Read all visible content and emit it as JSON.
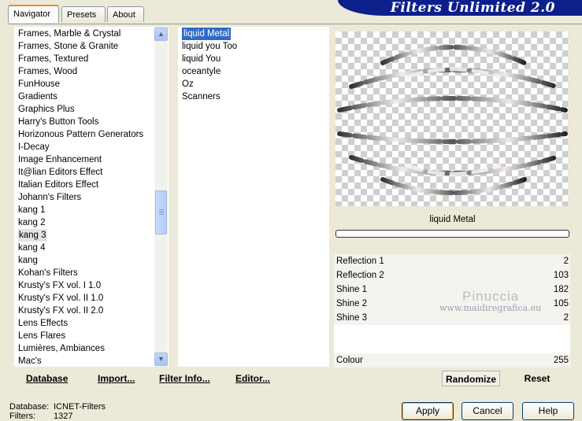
{
  "tabs": {
    "navigator": "Navigator",
    "presets": "Presets",
    "about": "About"
  },
  "banner": {
    "title": "Filters Unlimited 2.0"
  },
  "categories": [
    "Frames, Marble & Crystal",
    "Frames, Stone & Granite",
    "Frames, Textured",
    "Frames, Wood",
    "FunHouse",
    "Gradients",
    "Graphics Plus",
    "Harry's Button Tools",
    "Horizonous Pattern Generators",
    "I-Decay",
    "Image Enhancement",
    "It@lian Editors Effect",
    "Italian Editors Effect",
    "Johann's Filters",
    "kang 1",
    "kang 2",
    "kang 3",
    "kang 4",
    "kang",
    "Kohan's Filters",
    "Krusty's FX vol. I 1.0",
    "Krusty's FX vol. II 1.0",
    "Krusty's FX vol. II 2.0",
    "Lens Effects",
    "Lens Flares",
    "Lumières, Ambiances",
    "Mac's"
  ],
  "selected_category": "kang 3",
  "filters": [
    "liquid Metal",
    "liquid you Too",
    "liquid You",
    "oceantyle",
    "Oz",
    "Scanners"
  ],
  "selected_filter": "liquid Metal",
  "preview": {
    "filter_name": "liquid Metal"
  },
  "params": [
    {
      "label": "Reflection 1",
      "value": "2"
    },
    {
      "label": "Reflection 2",
      "value": "103"
    },
    {
      "label": "Shine 1",
      "value": "182"
    },
    {
      "label": "Shine 2",
      "value": "105"
    },
    {
      "label": "Shine 3",
      "value": "2"
    },
    {
      "label": "Colour",
      "value": "255"
    }
  ],
  "watermark": {
    "line1": "Pinuccia",
    "line2": "www.maidiregrafica.eu"
  },
  "actions": {
    "database": "Database",
    "import": "Import...",
    "filter_info": "Filter Info...",
    "editor": "Editor...",
    "randomize": "Randomize",
    "reset": "Reset"
  },
  "footer": {
    "database_label": "Database:",
    "database_value": "ICNET-Filters",
    "filters_label": "Filters:",
    "filters_value": "1327"
  },
  "dialog_buttons": {
    "apply": "Apply",
    "cancel": "Cancel",
    "help": "Help"
  },
  "colors": {
    "banner": "#0c1f8a",
    "selection": "#316ac5",
    "tab_highlight": "#e68b2c"
  }
}
